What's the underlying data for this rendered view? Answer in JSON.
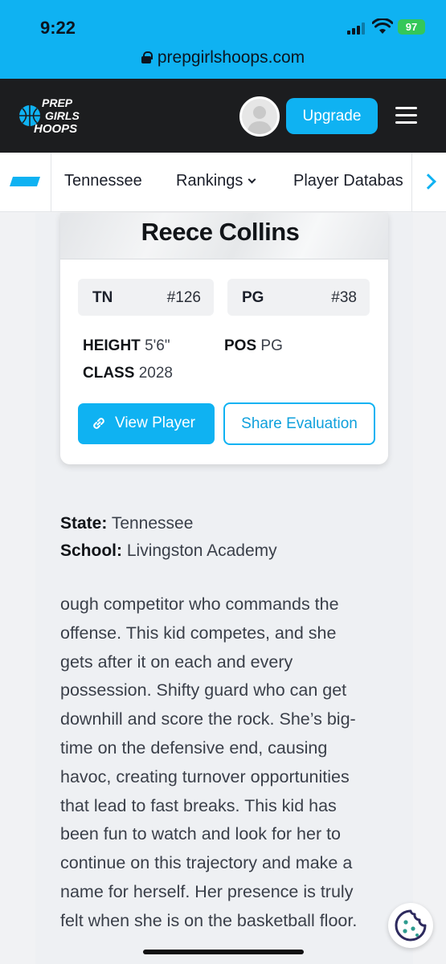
{
  "status_bar": {
    "time": "9:22",
    "battery": "97",
    "url": "prepgirlshoops.com"
  },
  "header": {
    "logo_text": "PREP GIRLS HOOPS",
    "upgrade_label": "Upgrade"
  },
  "nav": {
    "items": [
      {
        "label": "Tennessee"
      },
      {
        "label": "Rankings"
      },
      {
        "label": "Player Databas"
      }
    ]
  },
  "player_card": {
    "name": "Reece Collins",
    "rankings": [
      {
        "label": "TN",
        "value": "#126"
      },
      {
        "label": "PG",
        "value": "#38"
      }
    ],
    "height_label": "HEIGHT",
    "height_value": "5'6\"",
    "pos_label": "POS",
    "pos_value": "PG",
    "class_label": "CLASS",
    "class_value": "2028",
    "view_player_label": "View Player",
    "share_label": "Share Evaluation"
  },
  "details": {
    "state_label": "State:",
    "state_value": "Tennessee",
    "school_label": "School:",
    "school_value": "Livingston Academy"
  },
  "evaluation_lines": [
    "ough competitor who commands the",
    "offense. This kid competes, and she",
    "gets after it on each and every",
    "possession. Shifty guard who can get",
    "downhill and score the rock. She’s big-",
    "time on the defensive end, causing",
    "havoc, creating turnover opportunities",
    "that lead to fast breaks. This kid has",
    "been fun to watch and look for her to",
    "continue on this trajectory and make a",
    "name for herself. Her presence is truly",
    "felt when she is on the basketball floor."
  ],
  "colors": {
    "accent": "#0fb2f2",
    "header_bg": "#1c1d1f"
  }
}
